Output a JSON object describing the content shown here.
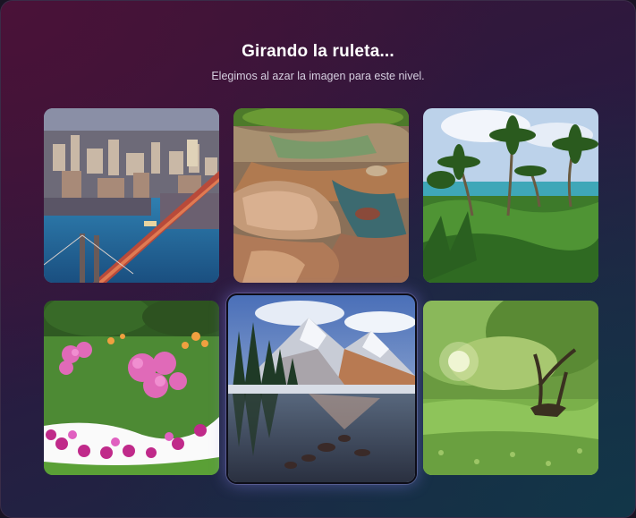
{
  "header": {
    "title": "Girando la ruleta...",
    "subtitle": "Elegimos al azar la imagen para este nivel."
  },
  "tiles": [
    {
      "name": "city-bridge-image",
      "selected": false
    },
    {
      "name": "river-rocks-image",
      "selected": false
    },
    {
      "name": "palm-beach-image",
      "selected": false
    },
    {
      "name": "flower-garden-image",
      "selected": false
    },
    {
      "name": "mountain-lake-image",
      "selected": true
    },
    {
      "name": "sunlit-forest-image",
      "selected": false
    }
  ]
}
